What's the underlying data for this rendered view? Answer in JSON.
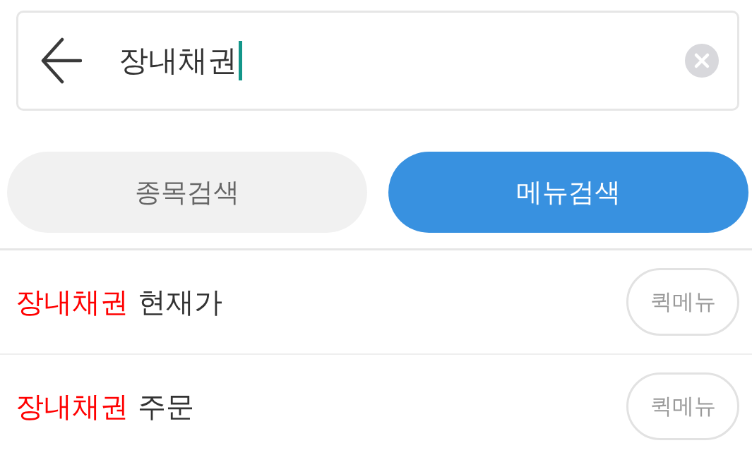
{
  "search_bar": {
    "value": "장내채권"
  },
  "tabs": [
    {
      "label": "종목검색",
      "selected": false
    },
    {
      "label": "메뉴검색",
      "selected": true
    }
  ],
  "results": [
    {
      "match": "장내채권",
      "rest": "현재가",
      "button": "퀵메뉴"
    },
    {
      "match": "장내채권",
      "rest": "주문",
      "button": "퀵메뉴"
    }
  ]
}
